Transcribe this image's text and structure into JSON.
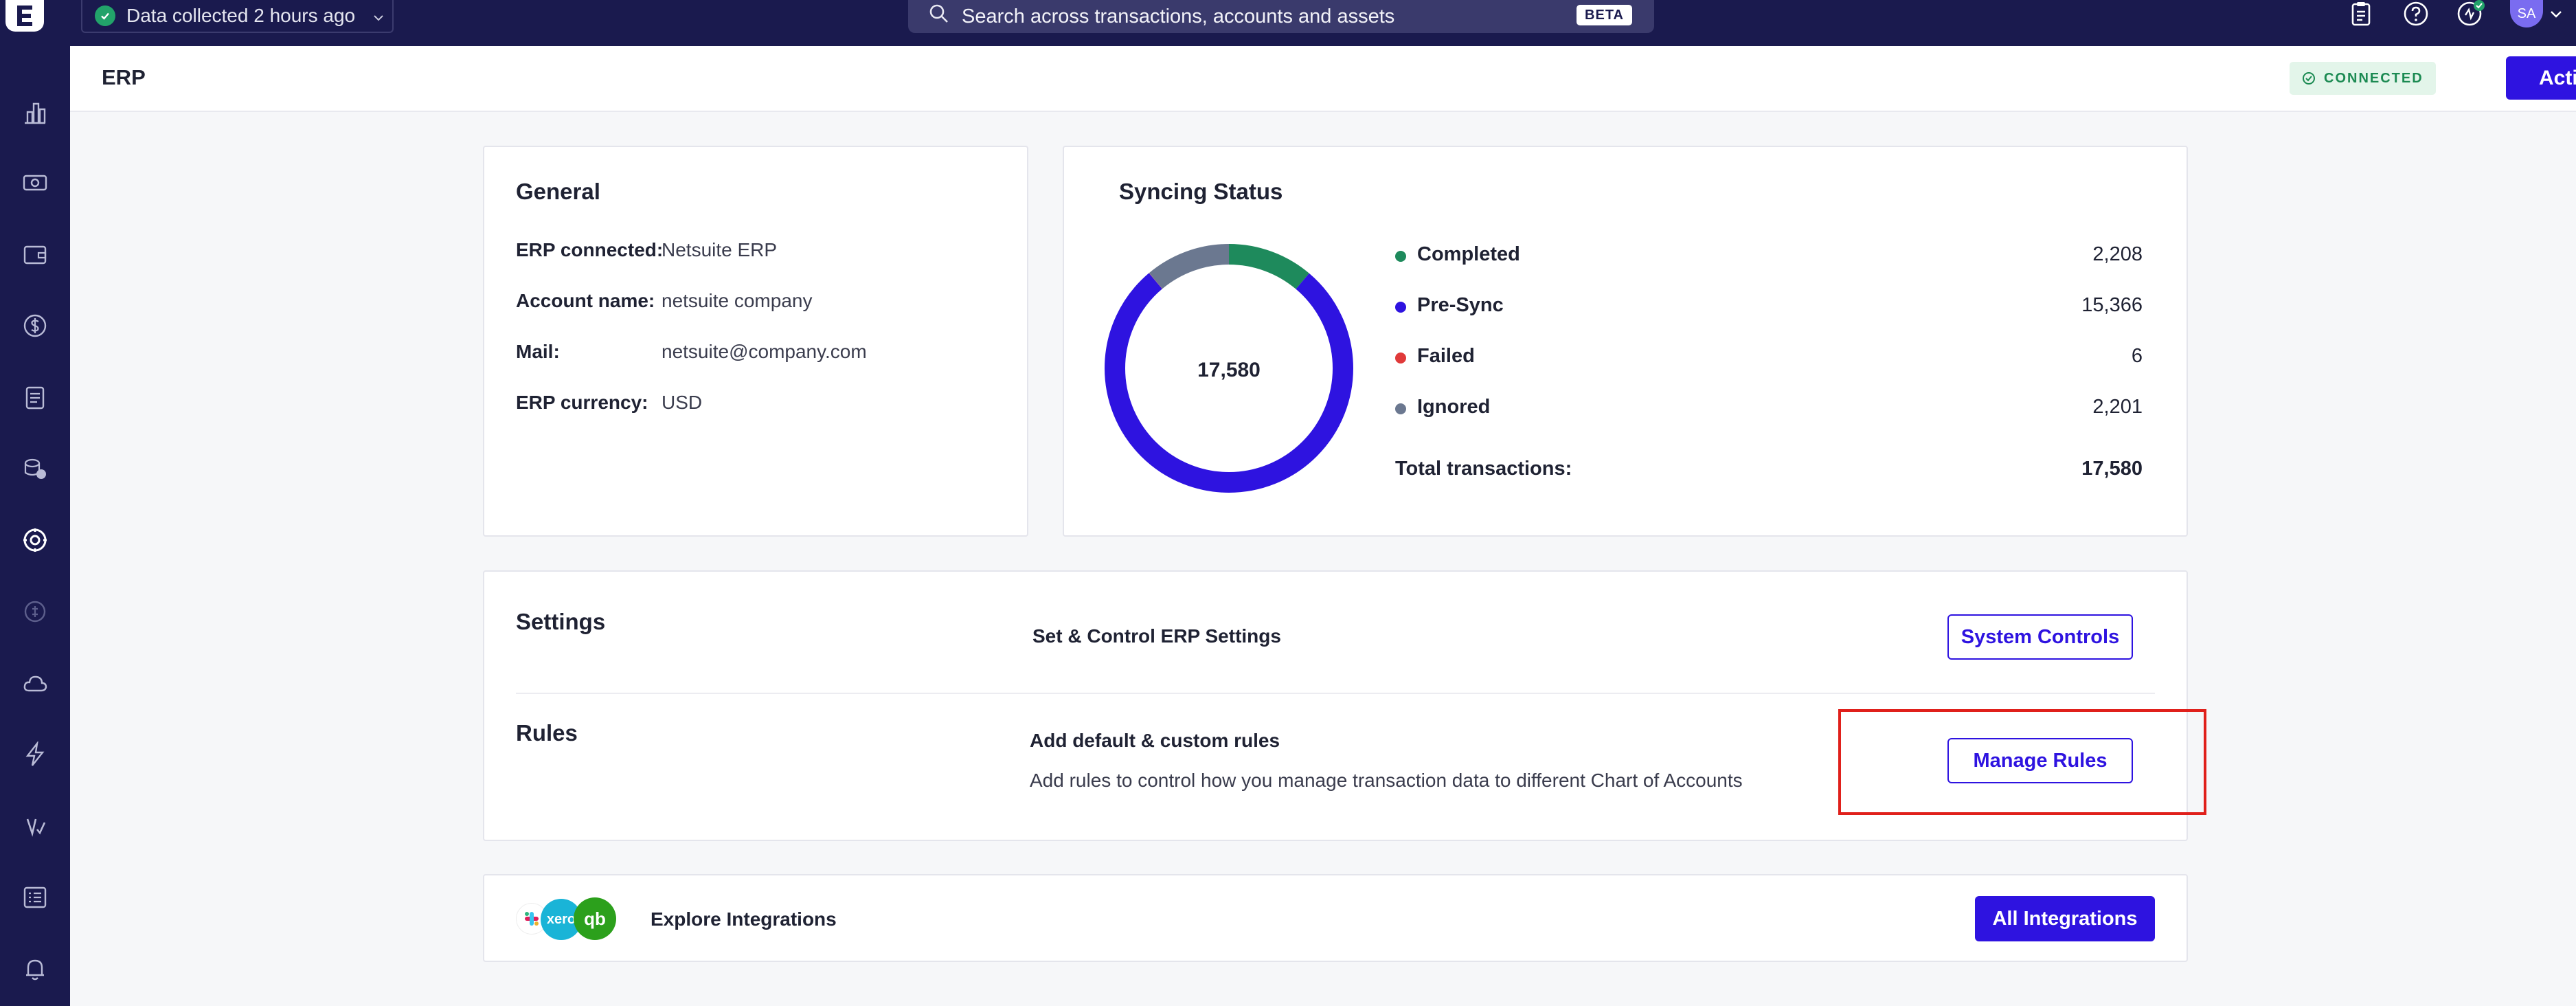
{
  "topbar": {
    "data_status": "Data collected 2 hours ago",
    "search_placeholder": "Search across transactions, accounts and assets",
    "search_badge": "BETA",
    "avatar_initials": "SA"
  },
  "header": {
    "title": "ERP",
    "status_badge": "CONNECTED",
    "actions_label": "Actions"
  },
  "general": {
    "title": "General",
    "rows": [
      {
        "label": "ERP connected:",
        "value": "Netsuite ERP"
      },
      {
        "label": "Account name:",
        "value": "netsuite company"
      },
      {
        "label": "Mail:",
        "value": "netsuite@company.com"
      },
      {
        "label": "ERP currency:",
        "value": "USD"
      }
    ]
  },
  "syncing": {
    "title": "Syncing Status",
    "total_center": "17,580",
    "total_label": "Total transactions:",
    "total_value": "17,580"
  },
  "chart_data": {
    "type": "pie",
    "title": "Syncing Status",
    "categories": [
      "Completed",
      "Pre-Sync",
      "Failed",
      "Ignored"
    ],
    "values": [
      2208,
      15366,
      6,
      2201
    ],
    "display_values": [
      "2,208",
      "15,366",
      "6",
      "2,201"
    ],
    "colors": [
      "#1e8a5c",
      "#2e13e0",
      "#e03a3a",
      "#6b7890"
    ],
    "donut": true,
    "center_label": "17,580",
    "legend_position": "right"
  },
  "settings": {
    "title": "Settings",
    "description": "Set & Control ERP Settings",
    "button": "System Controls"
  },
  "rules": {
    "title": "Rules",
    "description": "Add default & custom rules",
    "subtext": "Add rules to control how you manage transaction data to different Chart of Accounts",
    "button": "Manage Rules"
  },
  "integrations": {
    "label": "Explore Integrations",
    "button": "All Integrations",
    "logos": [
      "slack",
      "xero",
      "qb"
    ],
    "xero_text": "xero",
    "qb_text": "qb"
  },
  "colors": {
    "accent": "#2e13e0",
    "nav": "#1a1a4e",
    "connected_green": "#1b8a52",
    "highlight_red": "#e0201b"
  }
}
